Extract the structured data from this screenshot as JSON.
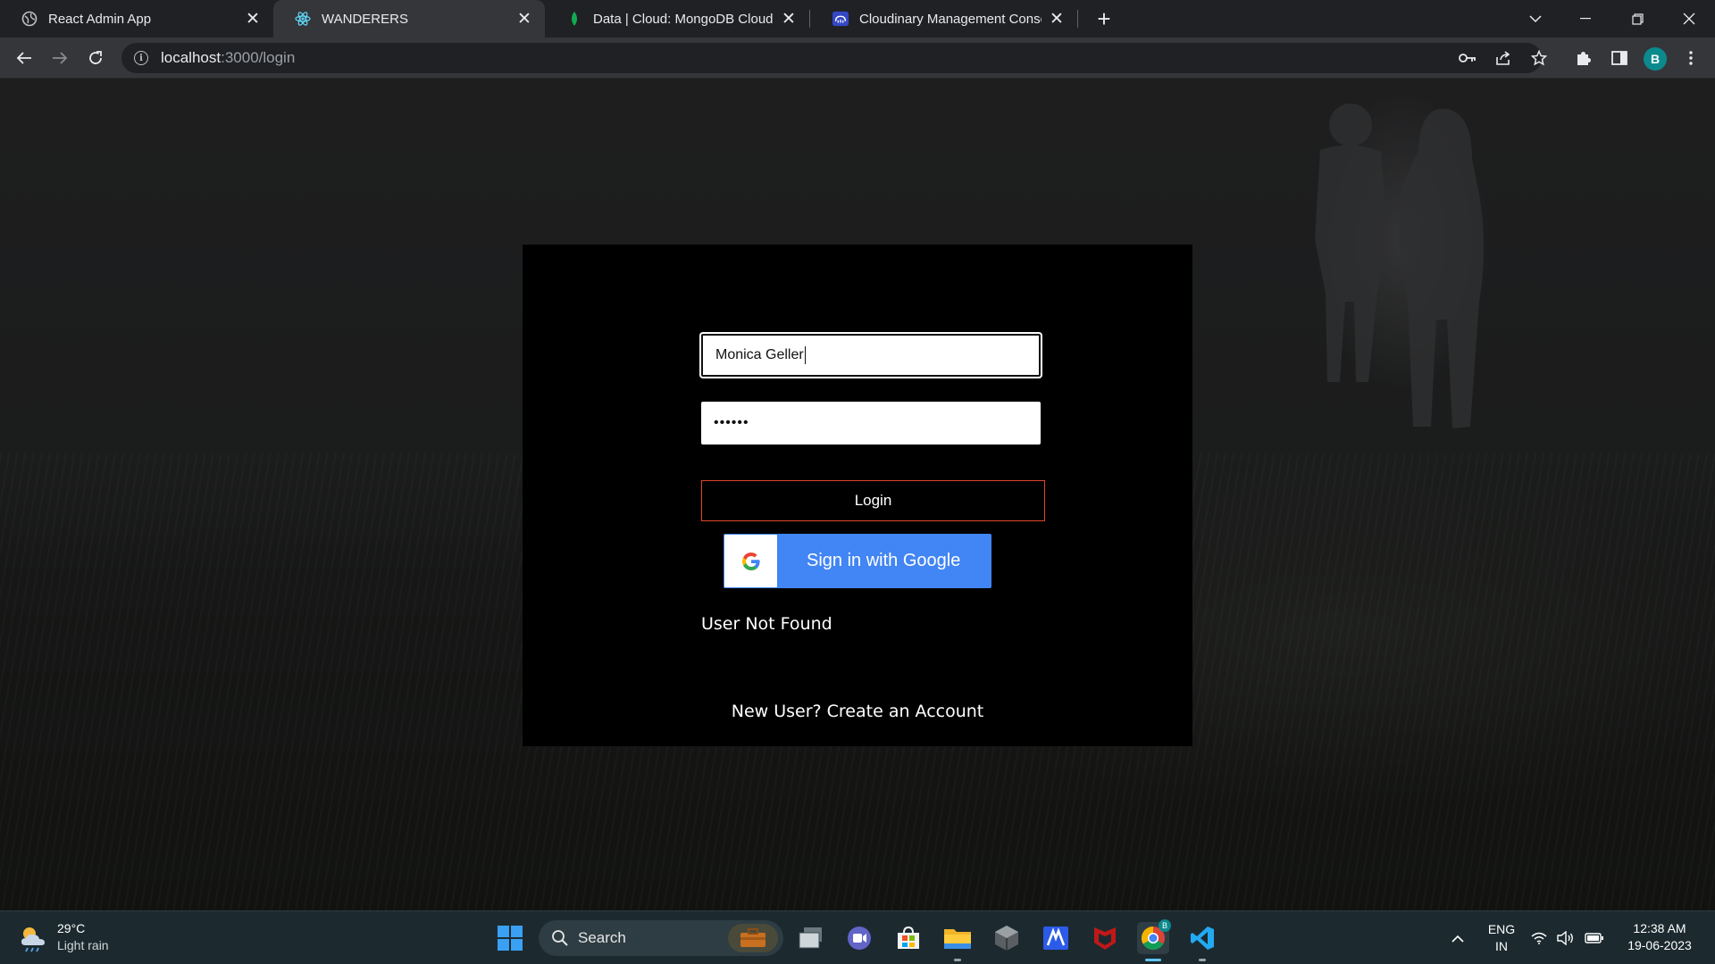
{
  "browser": {
    "tabs": [
      {
        "title": "React Admin App",
        "favicon": "globe-icon",
        "active": false
      },
      {
        "title": "WANDERERS",
        "favicon": "react-icon",
        "active": true
      },
      {
        "title": "Data | Cloud: MongoDB Cloud",
        "favicon": "mongodb-leaf-icon",
        "active": false
      },
      {
        "title": "Cloudinary Management Console",
        "favicon": "cloudinary-icon",
        "active": false
      }
    ],
    "url": {
      "host": "localhost",
      "path": ":3000/login"
    },
    "profile_initial": "B"
  },
  "login": {
    "username_value": "Monica Geller",
    "password_mask": "••••••",
    "login_label": "Login",
    "google_label": "Sign in with Google",
    "error_message": "User Not Found",
    "create_account": "New User? Create an Account"
  },
  "colors": {
    "google_blue": "#4285f4",
    "login_border": "#e0472a",
    "card_bg": "#000000"
  },
  "taskbar": {
    "weather_temp": "29°C",
    "weather_desc": "Light rain",
    "search_label": "Search",
    "lang_primary": "ENG",
    "lang_secondary": "IN",
    "time": "12:38 AM",
    "date": "19-06-2023",
    "chrome_badge": "B"
  }
}
